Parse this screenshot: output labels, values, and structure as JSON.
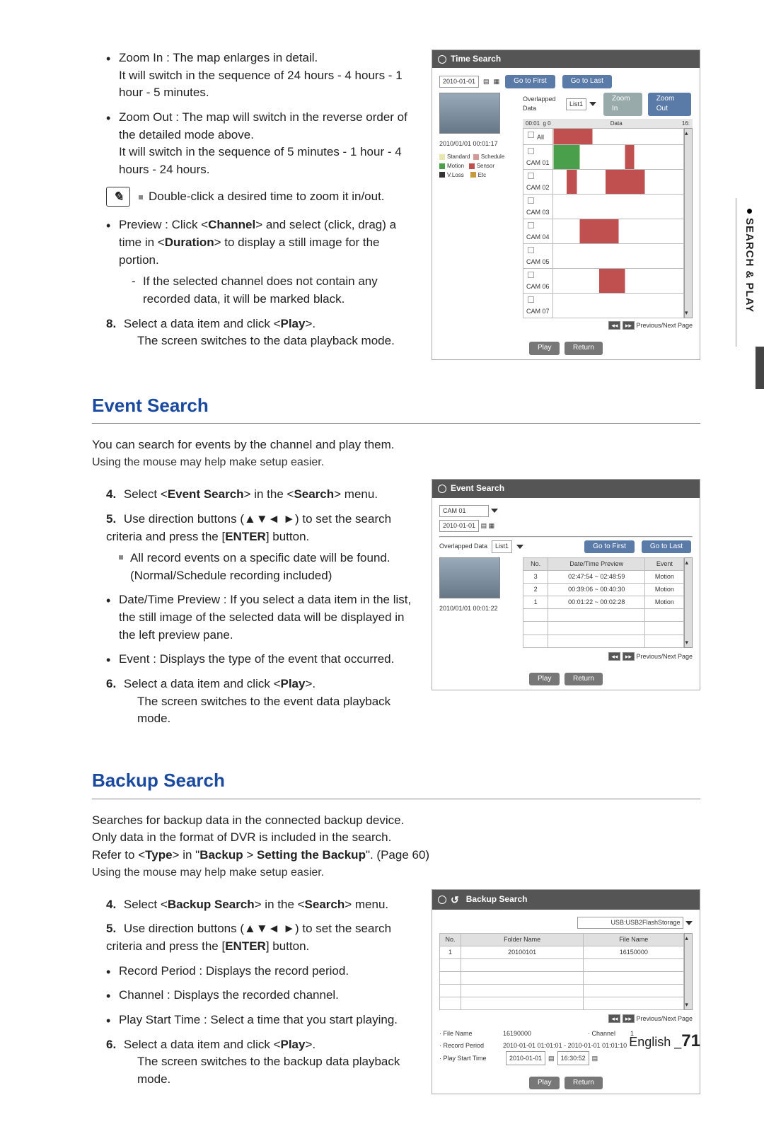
{
  "sideTab": "SEARCH & PLAY",
  "top": {
    "zoomIn": {
      "title": "Zoom In : The map enlarges in detail.",
      "line2": "It will switch in the sequence of 24 hours - 4 hours - 1 hour - 5 minutes."
    },
    "zoomOut": {
      "title": "Zoom Out : The map will switch in the reverse order of the detailed mode above.",
      "line2": "It will switch in the sequence of 5 minutes - 1 hour - 4 hours - 24 hours."
    },
    "note": "Double-click a desired time to zoom it in/out.",
    "preview": "Preview : Click <Channel> and select (click, drag) a time in <Duration> to display a still image for the portion.",
    "previewSub": "If the selected channel does not contain any recorded data, it will be marked black.",
    "step8a": "Select a data item and click <Play>.",
    "step8b": "The screen switches to the data playback mode."
  },
  "timeShot": {
    "title": "Time Search",
    "date": "2010-01-01",
    "goFirst": "Go to First",
    "goLast": "Go to Last",
    "overlap": "Overlapped Data",
    "list": "List1",
    "zoomIn": "Zoom In",
    "zoomOut": "Zoom Out",
    "dataLabel": "Data",
    "scaleStart": "00:01",
    "scaleEnd": "16:",
    "g0": "g 0",
    "timestamp": "2010/01/01 00:01:17",
    "channels": [
      "All",
      "CAM 01",
      "CAM 02",
      "CAM 03",
      "CAM 04",
      "CAM 05",
      "CAM 06",
      "CAM 07"
    ],
    "legend": [
      {
        "label": "Standard",
        "color": "#e8e8b0"
      },
      {
        "label": "Schedule",
        "color": "#d49a9a"
      },
      {
        "label": "Motion",
        "color": "#4aa04a"
      },
      {
        "label": "Sensor",
        "color": "#c05050"
      },
      {
        "label": "V.Loss",
        "color": "#333"
      },
      {
        "label": "Etc",
        "color": "#c89a40"
      }
    ],
    "prevNext": "Previous/Next Page",
    "play": "Play",
    "return": "Return"
  },
  "eventSection": {
    "heading": "Event Search",
    "intro1": "You can search for events by the channel and play them.",
    "intro2": "Using the mouse may help make setup easier.",
    "step4": "Select <Event Search> in the <Search> menu.",
    "step5": "Use direction buttons (▲▼◄ ►) to set the search criteria and press the [ENTER] button.",
    "sub5": "All record events on a specific date will be found. (Normal/Schedule recording included)",
    "bul1": "Date/Time Preview : If you select a data item in the list, the still image of the selected data will be displayed in the left preview pane.",
    "bul2": "Event : Displays the type of the event that occurred.",
    "step6a": "Select a data item and click <Play>.",
    "step6b": "The screen switches to the event data playback mode."
  },
  "eventShot": {
    "title": "Event Search",
    "cam": "CAM 01",
    "date": "2010-01-01",
    "overlap": "Overlapped Data",
    "list": "List1",
    "goFirst": "Go to First",
    "goLast": "Go to Last",
    "cols": [
      "No.",
      "Date/Time Preview",
      "Event"
    ],
    "rows": [
      {
        "no": "3",
        "dt": "02:47:54 ~ 02:48:59",
        "ev": "Motion"
      },
      {
        "no": "2",
        "dt": "00:39:06 ~ 00:40:30",
        "ev": "Motion"
      },
      {
        "no": "1",
        "dt": "00:01:22 ~ 00:02:28",
        "ev": "Motion"
      }
    ],
    "timestamp": "2010/01/01 00:01:22",
    "prevNext": "Previous/Next Page",
    "play": "Play",
    "return": "Return"
  },
  "backupSection": {
    "heading": "Backup Search",
    "intro1": "Searches for backup data in the connected backup device.",
    "intro2": "Only data in the format of DVR is included in the search.",
    "intro3": "Refer to <Type> in \"Backup > Setting the Backup\". (Page 60)",
    "intro4": "Using the mouse may help make setup easier.",
    "step4": "Select <Backup Search> in the <Search> menu.",
    "step5": "Use direction buttons (▲▼◄ ►) to set the search criteria and press the [ENTER] button.",
    "bul1": "Record Period : Displays the record period.",
    "bul2": "Channel : Displays the recorded channel.",
    "bul3": "Play Start Time : Select a time that you start playing.",
    "step6a": "Select a data item and click <Play>.",
    "step6b": "The screen switches to the backup data playback mode."
  },
  "backupShot": {
    "title": "Backup Search",
    "device": "USB:USB2FlashStorage",
    "cols": [
      "No.",
      "Folder Name",
      "File Name"
    ],
    "row": {
      "no": "1",
      "folder": "20100101",
      "file": "16150000"
    },
    "prevNext": "Previous/Next Page",
    "fileNameLabel": "· File Name",
    "fileNameVal": "16190000",
    "channelLabel": "· Channel",
    "channelVal": "1",
    "recPeriodLabel": "· Record Period",
    "recPeriodVal": "2010-01-01 01:01:01 - 2010-01-01 01:01:10",
    "playStartLabel": "· Play Start Time",
    "playStartDate": "2010-01-01",
    "playStartTime": "16:30:52",
    "play": "Play",
    "return": "Return"
  },
  "footer": {
    "lang": "English",
    "page": "71"
  }
}
